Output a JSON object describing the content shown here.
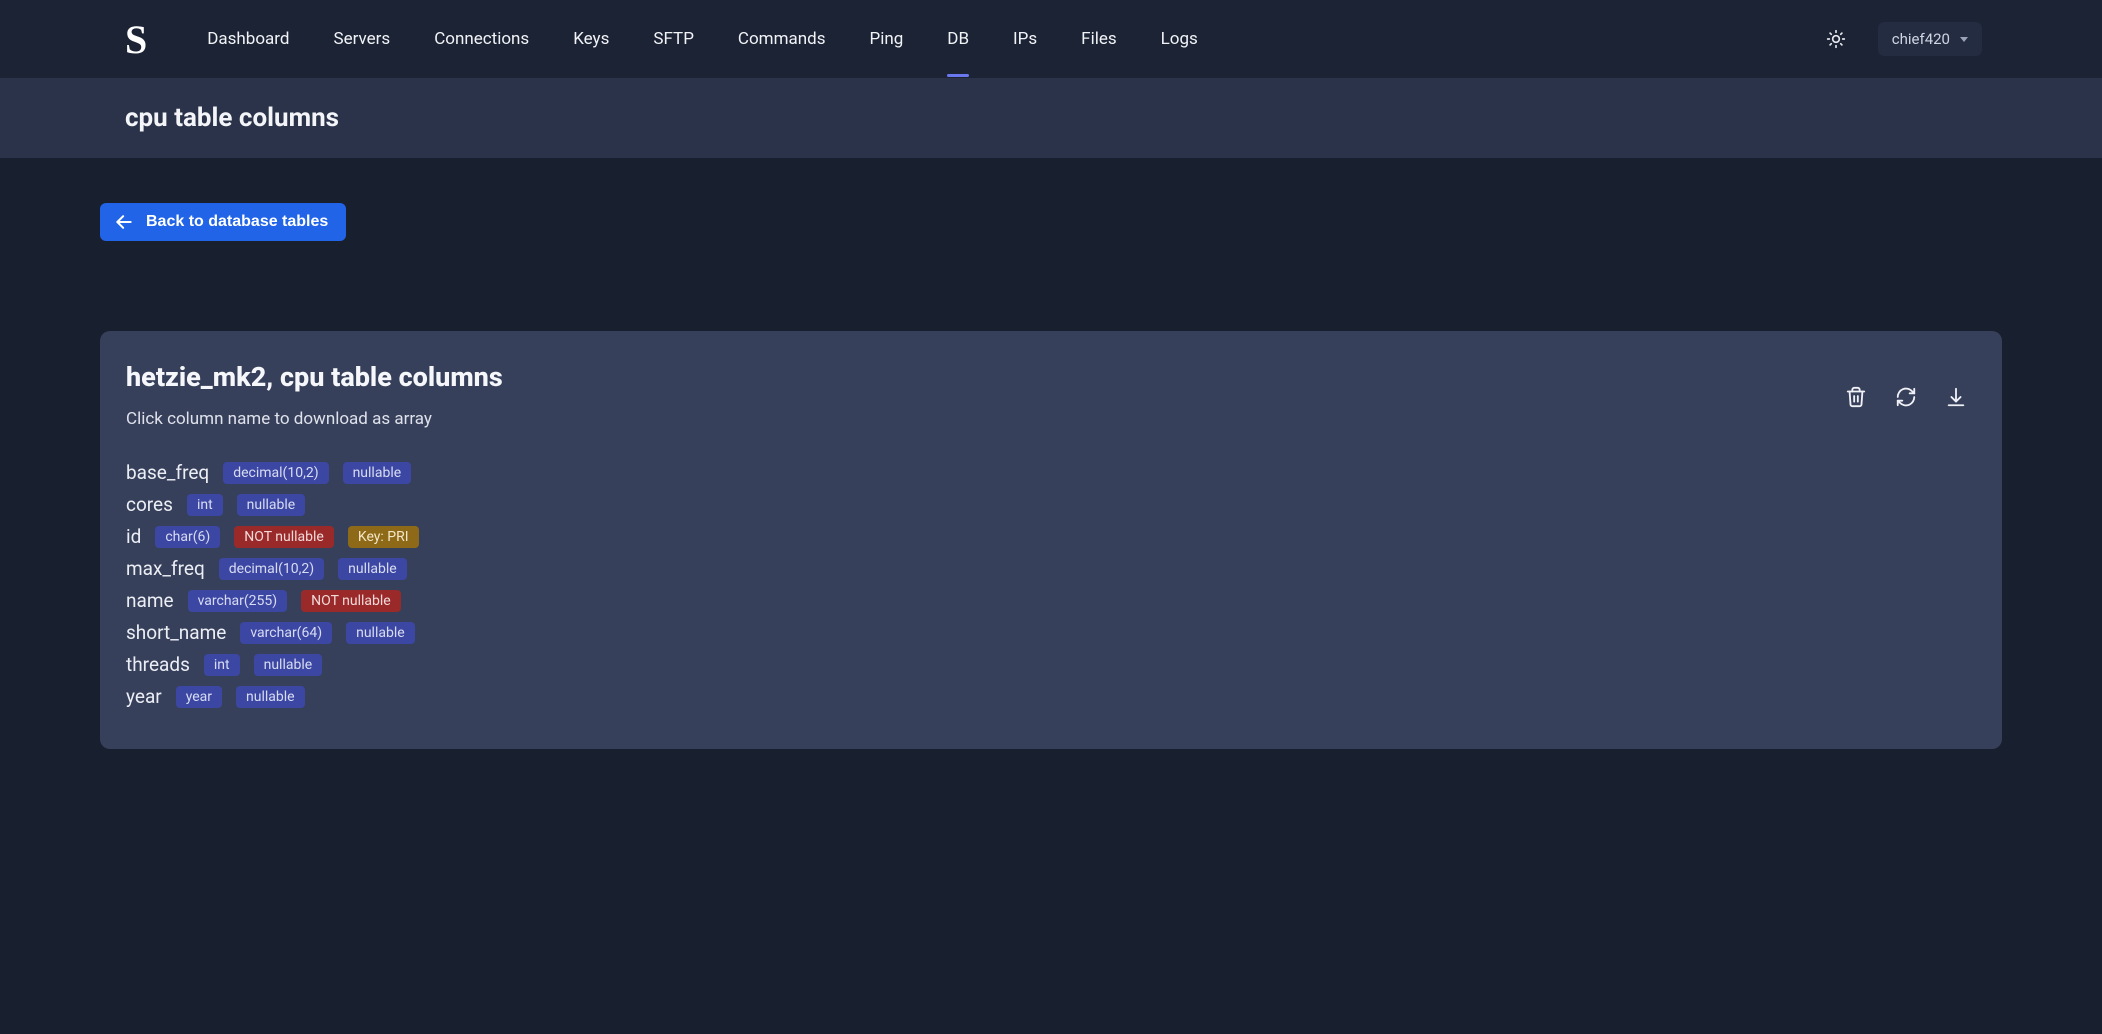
{
  "logo": "S",
  "nav": {
    "items": [
      {
        "label": "Dashboard",
        "active": false
      },
      {
        "label": "Servers",
        "active": false
      },
      {
        "label": "Connections",
        "active": false
      },
      {
        "label": "Keys",
        "active": false
      },
      {
        "label": "SFTP",
        "active": false
      },
      {
        "label": "Commands",
        "active": false
      },
      {
        "label": "Ping",
        "active": false
      },
      {
        "label": "DB",
        "active": true
      },
      {
        "label": "IPs",
        "active": false
      },
      {
        "label": "Files",
        "active": false
      },
      {
        "label": "Logs",
        "active": false
      }
    ]
  },
  "user": {
    "name": "chief420"
  },
  "subheader": {
    "title": "cpu table columns"
  },
  "back": {
    "label": "Back to database tables"
  },
  "card": {
    "title": "hetzie_mk2, cpu table columns",
    "subtitle": "Click column name to download as array"
  },
  "columns": [
    {
      "name": "base_freq",
      "type": "decimal(10,2)",
      "nullable": true,
      "key": null
    },
    {
      "name": "cores",
      "type": "int",
      "nullable": true,
      "key": null
    },
    {
      "name": "id",
      "type": "char(6)",
      "nullable": false,
      "key": "PRI"
    },
    {
      "name": "max_freq",
      "type": "decimal(10,2)",
      "nullable": true,
      "key": null
    },
    {
      "name": "name",
      "type": "varchar(255)",
      "nullable": false,
      "key": null
    },
    {
      "name": "short_name",
      "type": "varchar(64)",
      "nullable": true,
      "key": null
    },
    {
      "name": "threads",
      "type": "int",
      "nullable": true,
      "key": null
    },
    {
      "name": "year",
      "type": "year",
      "nullable": true,
      "key": null
    }
  ],
  "strings": {
    "nullable": "nullable",
    "not_nullable": "NOT nullable",
    "key_prefix": "Key: "
  }
}
